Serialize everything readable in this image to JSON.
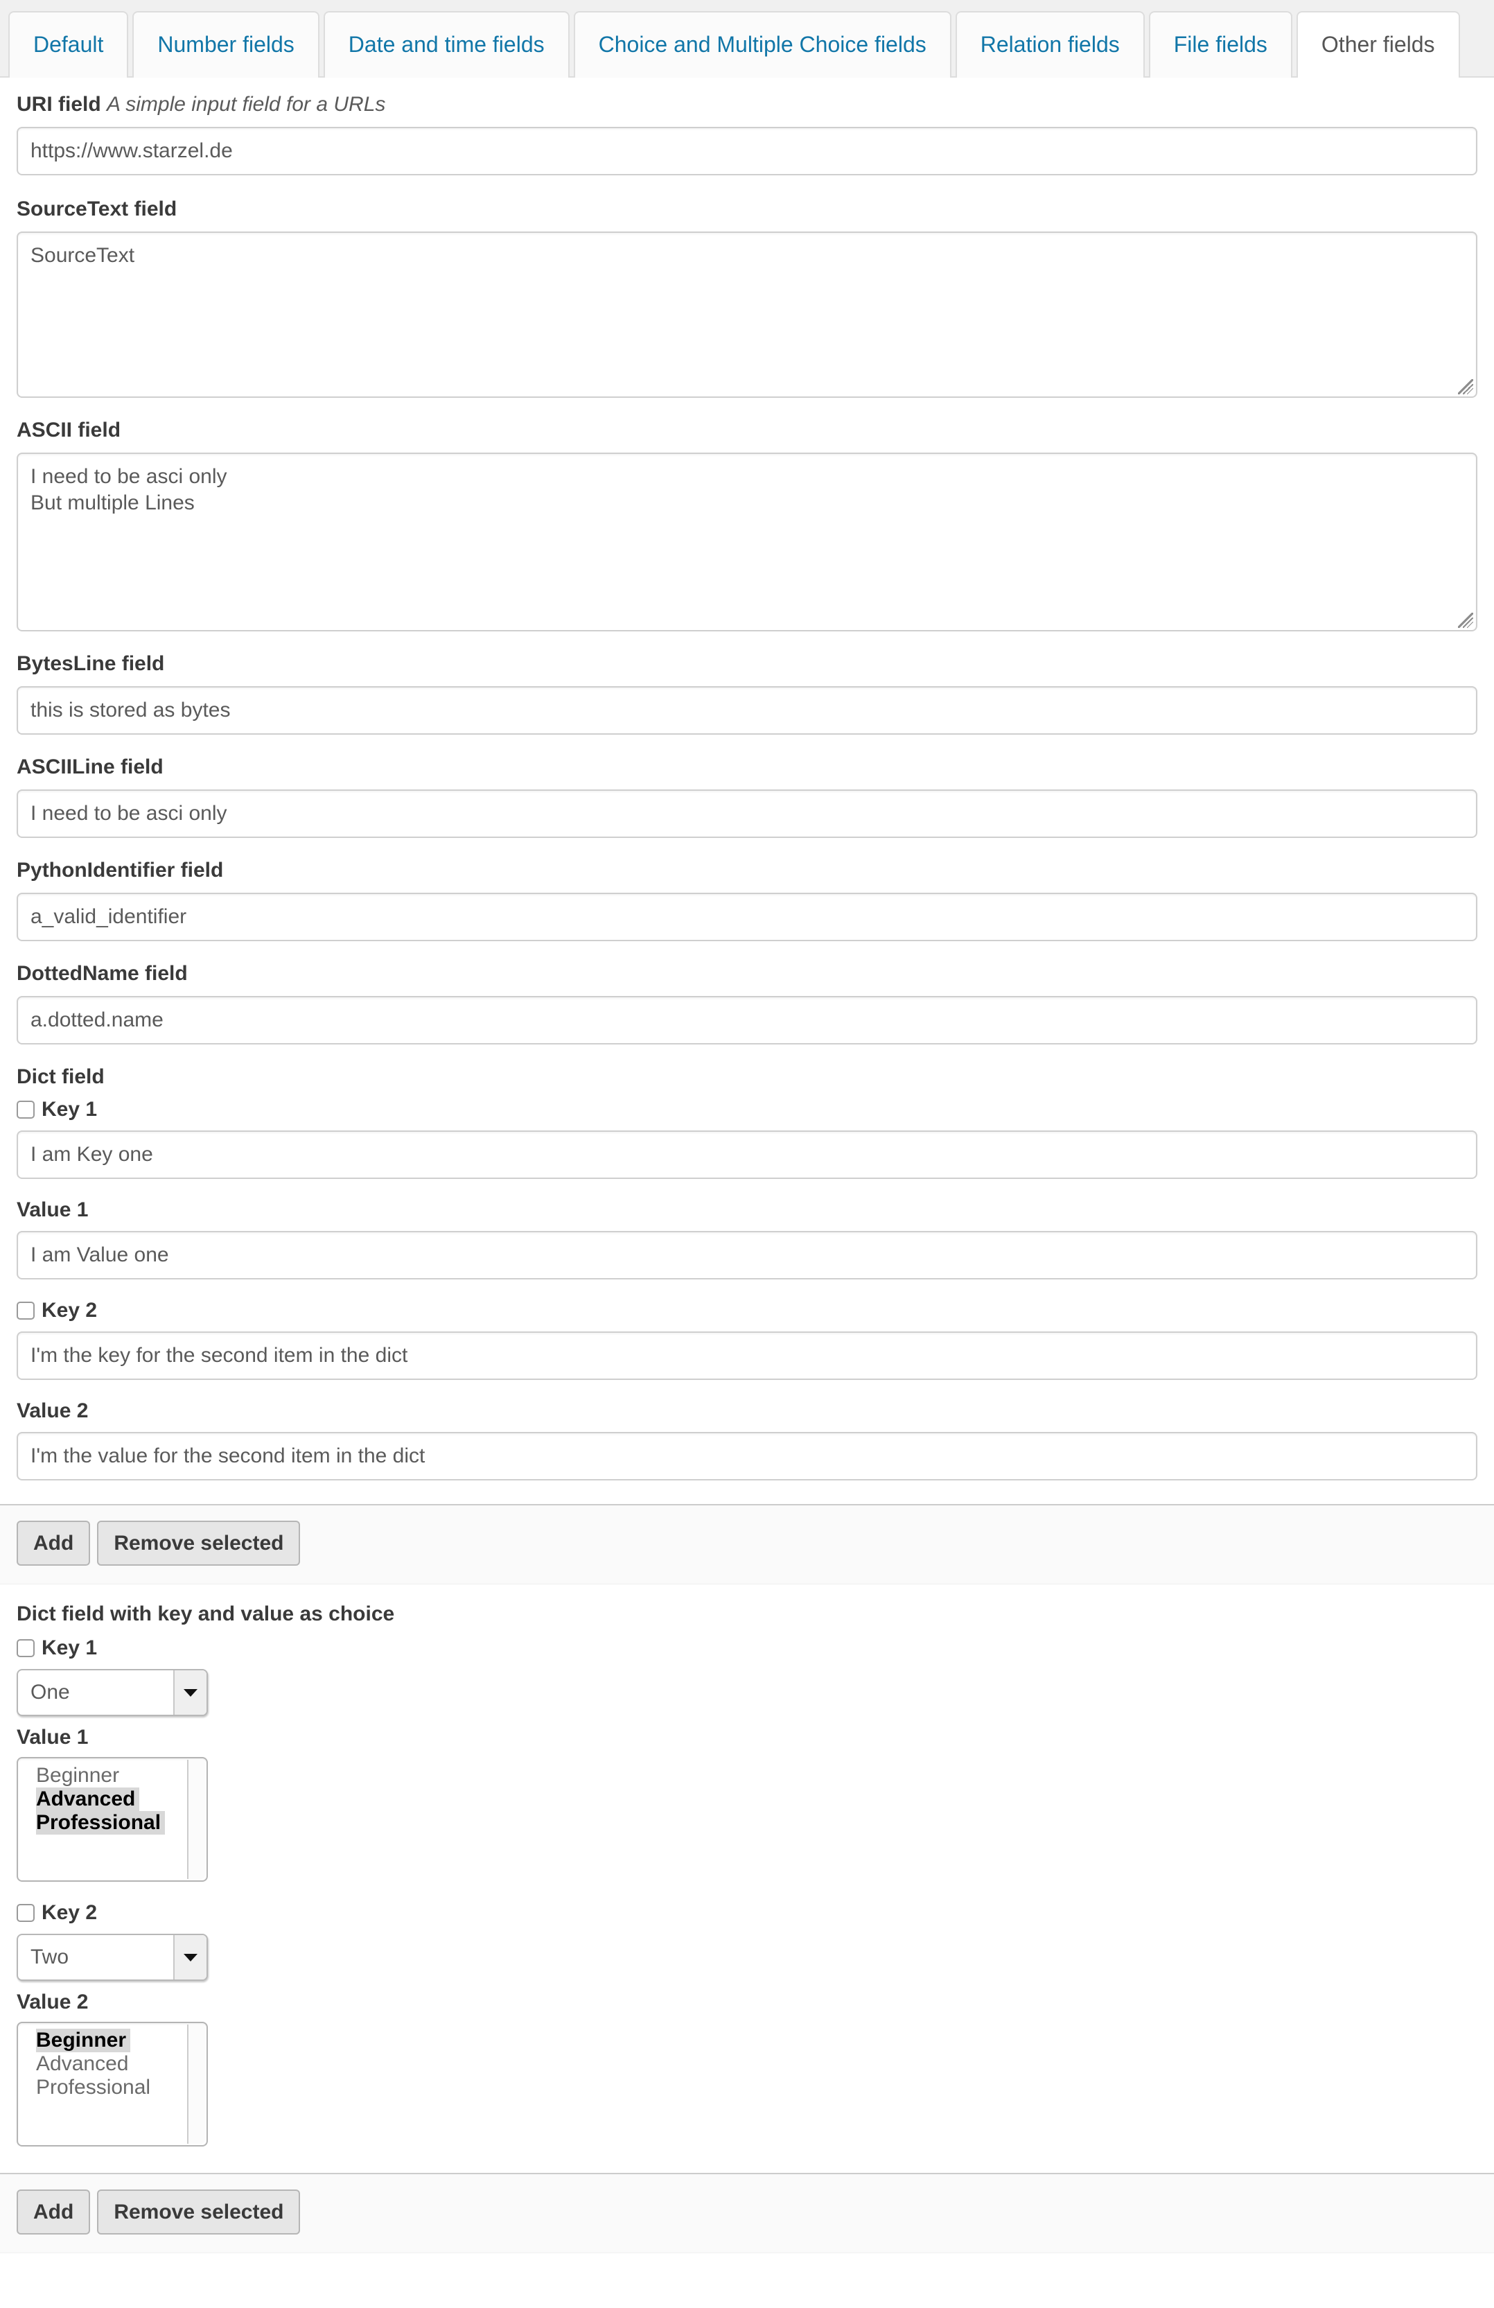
{
  "tabs": [
    {
      "label": "Default",
      "active": false
    },
    {
      "label": "Number fields",
      "active": false
    },
    {
      "label": "Date and time fields",
      "active": false
    },
    {
      "label": "Choice and Multiple Choice fields",
      "active": false
    },
    {
      "label": "Relation fields",
      "active": false
    },
    {
      "label": "File fields",
      "active": false
    },
    {
      "label": "Other fields",
      "active": true
    }
  ],
  "colors": {
    "tab_link": "#1176a8",
    "tab_active_text": "#555555",
    "label": "#3a3a3a",
    "input_text": "#5a5a5a",
    "toolbar_bg": "#fafafa",
    "option_selected_bg": "#d8d8d8"
  },
  "fields": {
    "uri": {
      "label": "URI field",
      "hint": "A simple input field for a URLs",
      "value": "https://www.starzel.de"
    },
    "sourcetext": {
      "label": "SourceText field",
      "value": "SourceText"
    },
    "ascii": {
      "label": "ASCII field",
      "value": "I need to be asci only\nBut multiple Lines"
    },
    "bytesline": {
      "label": "BytesLine field",
      "value": "this is stored as bytes"
    },
    "asciiline": {
      "label": "ASCIILine field",
      "value": "I need to be asci only"
    },
    "pythonidentifier": {
      "label": "PythonIdentifier field",
      "value": "a_valid_identifier"
    },
    "dottedname": {
      "label": "DottedName field",
      "value": "a.dotted.name"
    }
  },
  "dict_field": {
    "label": "Dict field",
    "rows": [
      {
        "key_label": "Key 1",
        "key_value": "I am Key one",
        "value_label": "Value 1",
        "value_value": "I am Value one",
        "key_checked": false
      },
      {
        "key_label": "Key 2",
        "key_value": "I'm the key for the second item in the dict",
        "value_label": "Value 2",
        "value_value": "I'm the value for the second item in the dict",
        "key_checked": false
      }
    ],
    "toolbar": {
      "add_label": "Add",
      "remove_label": "Remove selected"
    }
  },
  "dict_choice_field": {
    "label": "Dict field with key and value as choice",
    "rows": [
      {
        "key_label": "Key 1",
        "key_checked": false,
        "key_selected": "One",
        "value_label": "Value 1",
        "options": [
          {
            "label": "Beginner",
            "selected": false
          },
          {
            "label": "Advanced",
            "selected": true
          },
          {
            "label": "Professional",
            "selected": true
          }
        ]
      },
      {
        "key_label": "Key 2",
        "key_checked": false,
        "key_selected": "Two",
        "value_label": "Value 2",
        "options": [
          {
            "label": "Beginner",
            "selected": true
          },
          {
            "label": "Advanced",
            "selected": false
          },
          {
            "label": "Professional",
            "selected": false
          }
        ]
      }
    ],
    "toolbar": {
      "add_label": "Add",
      "remove_label": "Remove selected"
    }
  }
}
